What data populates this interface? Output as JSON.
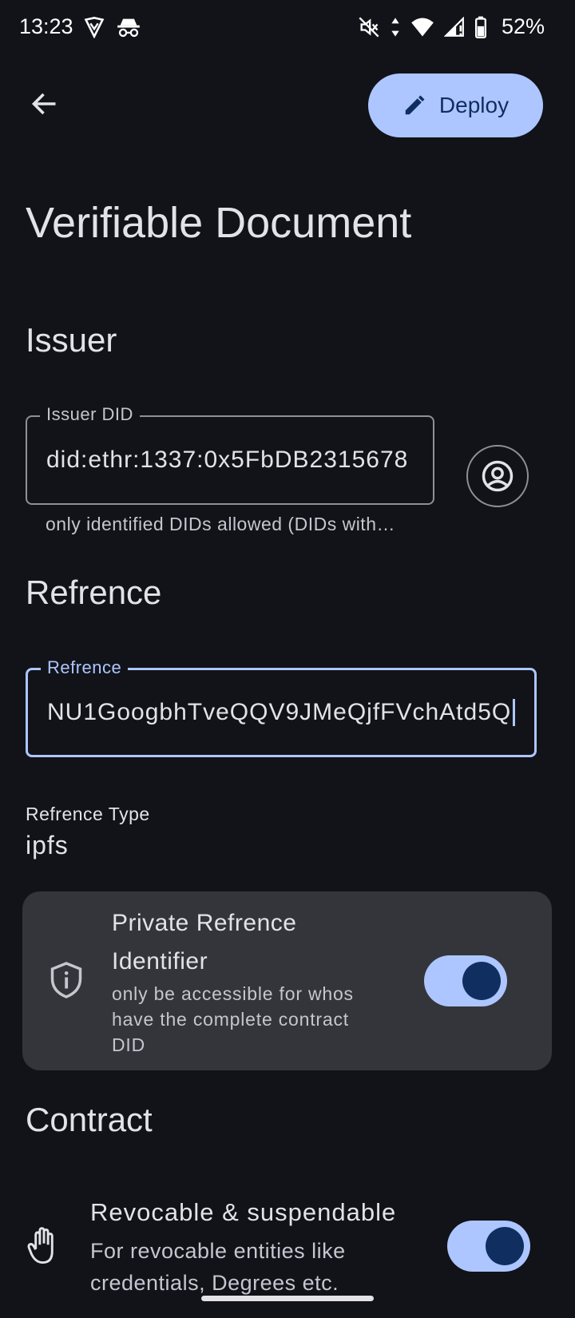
{
  "status_bar": {
    "time": "13:23",
    "battery_percent": "52%",
    "icons_left": [
      "vpn-shield-icon",
      "incognito-icon"
    ],
    "icons_right": [
      "mute-icon",
      "data-arrows-icon",
      "wifi-icon",
      "signal-icon",
      "battery-icon"
    ]
  },
  "top_bar": {
    "back_icon": "arrow-back-icon",
    "deploy_label": "Deploy",
    "deploy_icon": "edit-pencil-icon"
  },
  "page_title": "Verifiable Document",
  "issuer": {
    "section_title": "Issuer",
    "field_label": "Issuer DID",
    "field_value": "did:ethr:1337:0x5FbDB2315678",
    "helper_text": "only identified DIDs allowed (DIDs with…",
    "account_icon": "account-circle-icon"
  },
  "reference": {
    "section_title": "Refrence",
    "field_label": "Refrence",
    "field_value": "NU1GoogbhTveQQV9JMeQjfFVchAtd5Q",
    "type_label": "Refrence Type",
    "type_value": "ipfs"
  },
  "private_card": {
    "title_line1": "Private Refrence",
    "title_line2": "Identifier",
    "subtitle_line1": "only be accessible for whos",
    "subtitle_line2": "have the complete contract",
    "subtitle_line3": "DID",
    "icon": "privacy-shield-info-icon",
    "toggle_on": true
  },
  "contract": {
    "section_title": "Contract",
    "revocable_title": "Revocable & suspendable",
    "revocable_sub_line1": "For revocable entities like",
    "revocable_sub_line2": "credentials, Degrees etc.",
    "revocable_icon": "hand-stop-icon",
    "toggle_on": true
  },
  "colors": {
    "background": "#111318",
    "primary": "#adc6ff",
    "on_primary": "#102f60",
    "card": "#34353a",
    "outline": "#8e9099"
  }
}
